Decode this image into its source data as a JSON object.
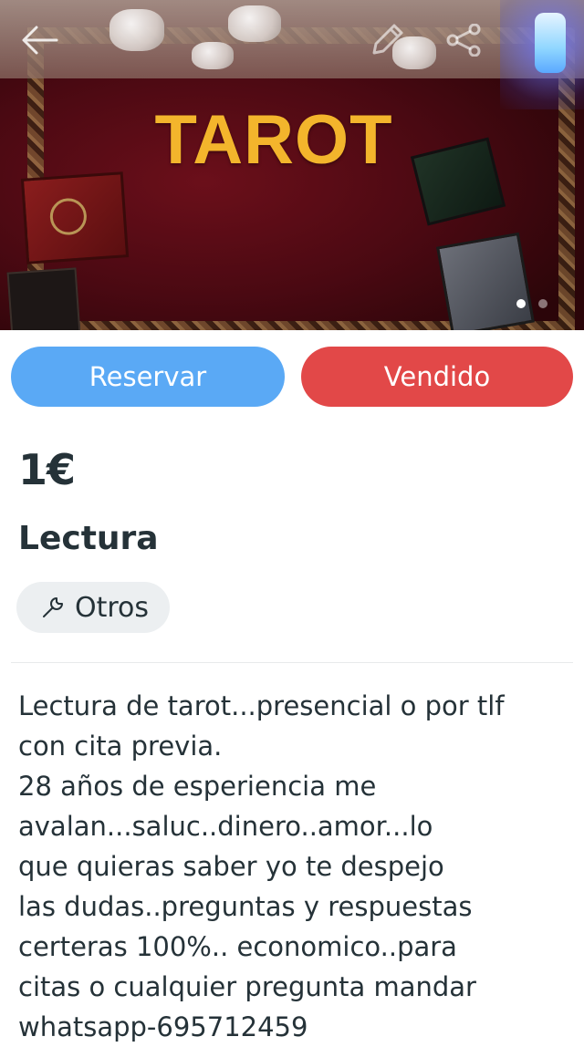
{
  "hero": {
    "title": "TAROT",
    "image_alt": "tarot-table-photo",
    "carousel": {
      "total": 2,
      "active": 1
    },
    "icons": {
      "back": "arrow-left-icon",
      "edit": "pencil-icon",
      "share": "share-icon"
    }
  },
  "actions": {
    "reserve_label": "Reservar",
    "sold_label": "Vendido",
    "reserve_color": "#5aa9f5",
    "sold_color": "#e24848"
  },
  "listing": {
    "price": "1€",
    "title": "Lectura",
    "category": "Otros",
    "category_icon": "wrench-icon",
    "description": "Lectura de tarot...presencial o por tlf\ncon cita previa.\n28 años de esperiencia me\navalan...saluc..dinero..amor...lo\nque quieras saber yo te despejo\nlas dudas..preguntas y respuestas\ncerteras 100%.. economico..para\ncitas o cualquier pregunta mandar\nwhatsapp-695712459"
  }
}
